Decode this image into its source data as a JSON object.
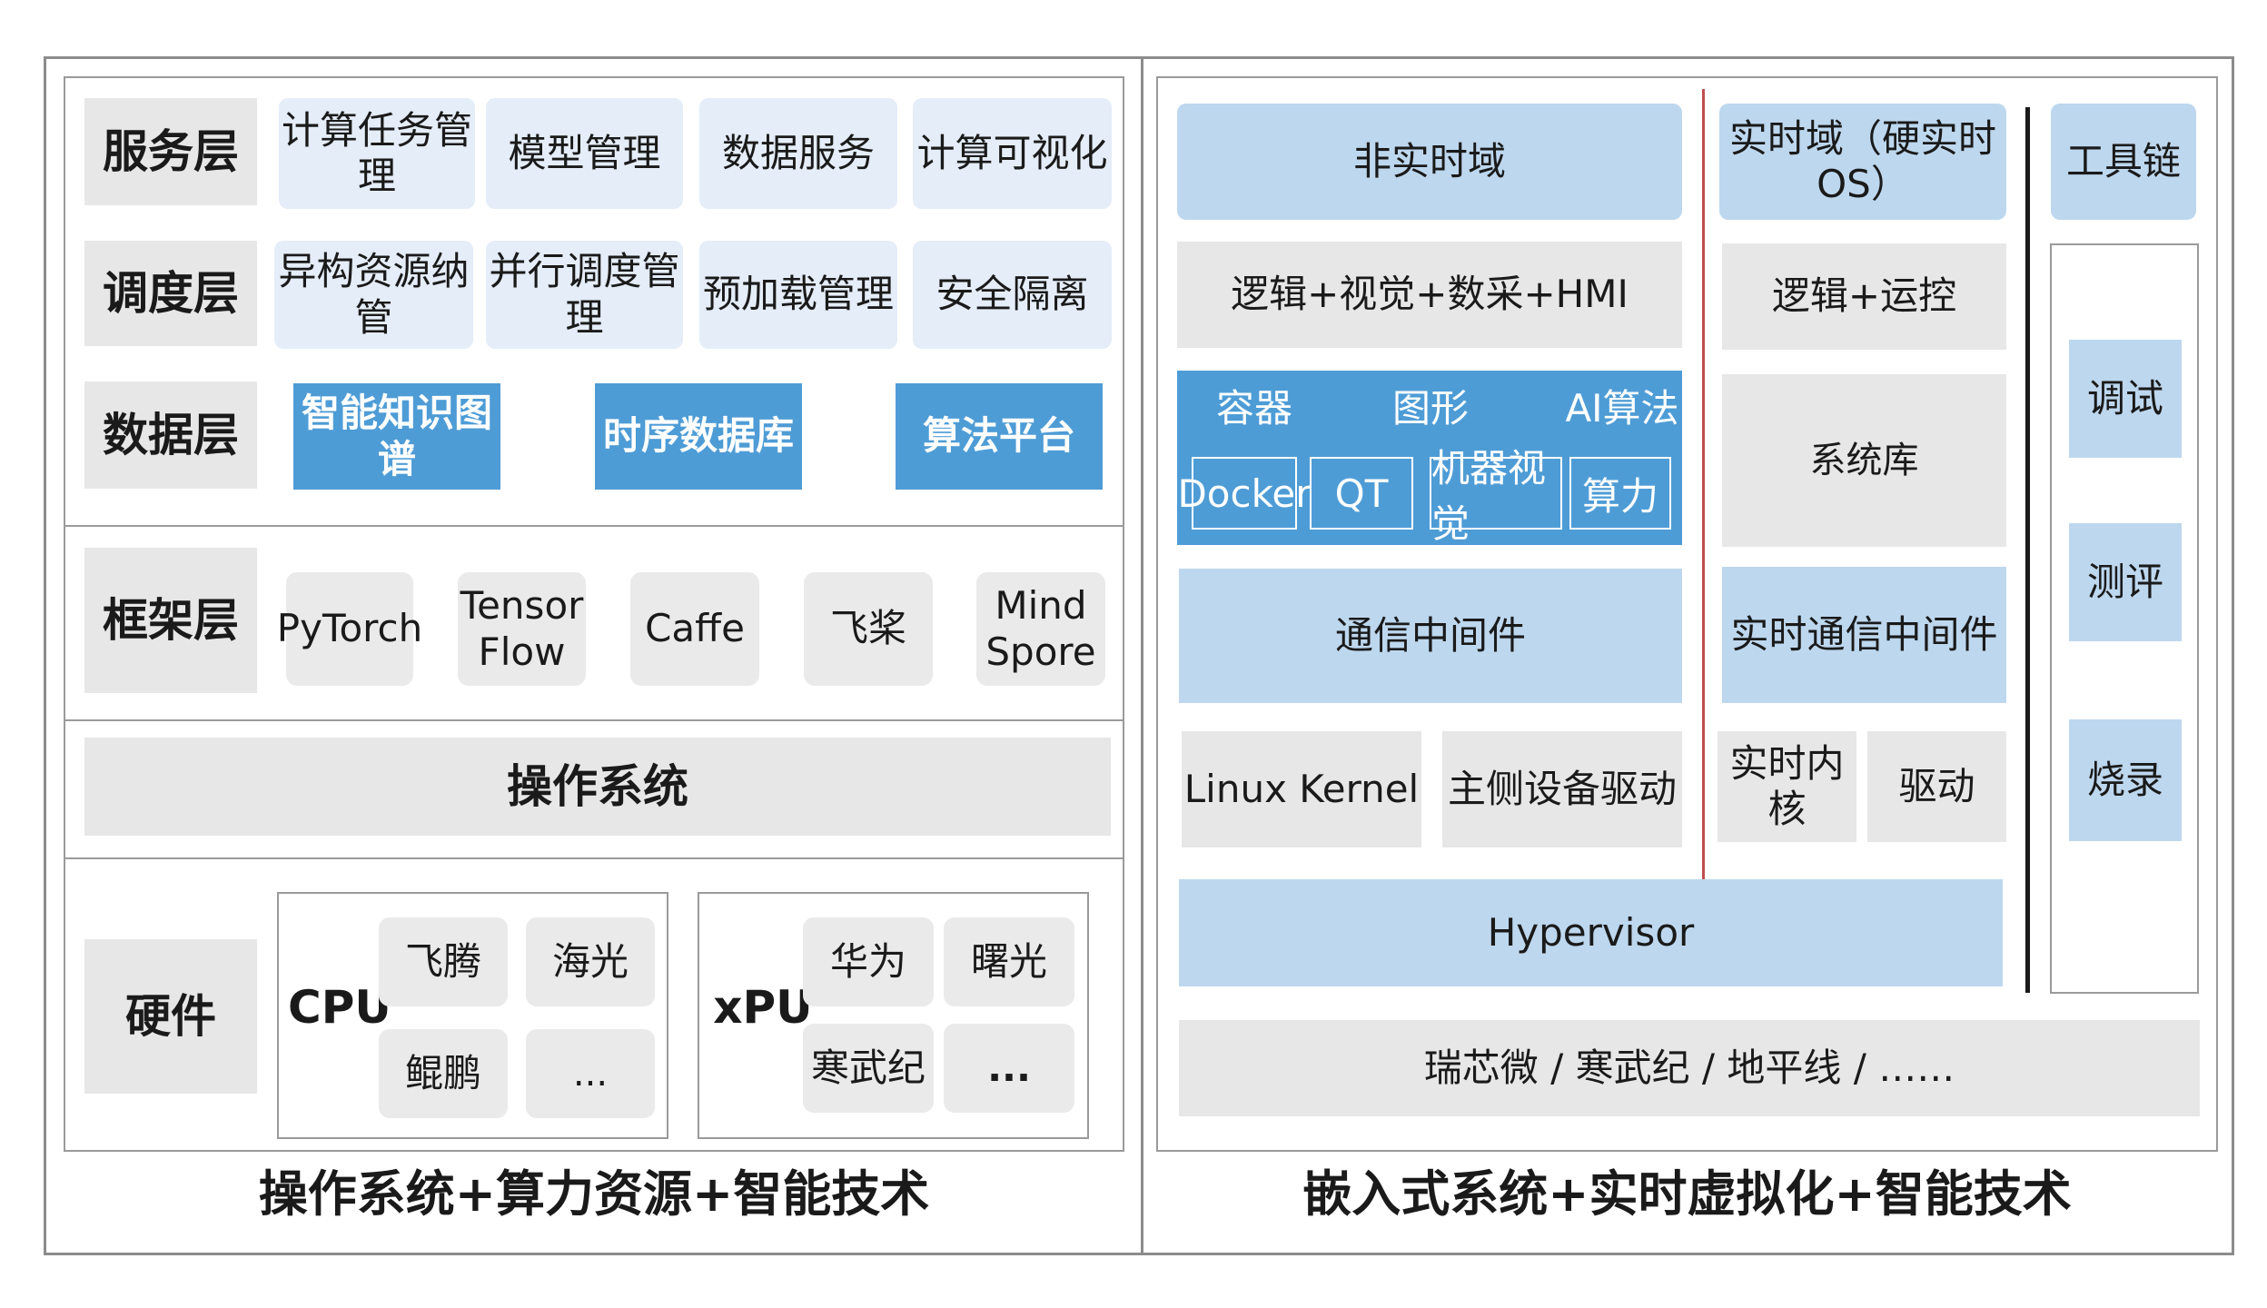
{
  "left": {
    "caption": "操作系统+算力资源+智能技术",
    "service_layer": {
      "label": "服务层",
      "items": [
        "计算任务管理",
        "模型管理",
        "数据服务",
        "计算可视化"
      ]
    },
    "schedule_layer": {
      "label": "调度层",
      "items": [
        "异构资源纳管",
        "并行调度管理",
        "预加载管理",
        "安全隔离"
      ]
    },
    "data_layer": {
      "label": "数据层",
      "items": [
        "智能知识图谱",
        "时序数据库",
        "算法平台"
      ]
    },
    "framework_layer": {
      "label": "框架层",
      "items": [
        "PyTorch",
        "Tensor\nFlow",
        "Caffe",
        "飞桨",
        "Mind\nSpore"
      ]
    },
    "os": {
      "label": "操作系统"
    },
    "hardware": {
      "label": "硬件",
      "cpu": {
        "label": "CPU",
        "items": [
          "飞腾",
          "海光",
          "鲲鹏",
          "..."
        ]
      },
      "xpu": {
        "label": "xPU",
        "items": [
          "华为",
          "曙光",
          "寒武纪",
          "..."
        ]
      }
    }
  },
  "right": {
    "caption": "嵌入式系统+实时虚拟化+智能技术",
    "non_rt": {
      "header": "非实时域",
      "app": "逻辑+视觉+数采+HMI",
      "container": {
        "labels": [
          "容器",
          "图形",
          "AI算法"
        ],
        "cells": [
          "Docker",
          "QT",
          "机器视觉",
          "算力"
        ]
      },
      "middleware": "通信中间件",
      "kernel": "Linux Kernel",
      "driver": "主侧设备驱动"
    },
    "rt": {
      "header": "实时域（硬实时OS）",
      "app": "逻辑+运控",
      "lib": "系统库",
      "middleware": "实时通信中间件",
      "kernel": "实时内核",
      "driver": "驱动"
    },
    "toolchain": {
      "header": "工具链",
      "items": [
        "调试",
        "测评",
        "烧录"
      ]
    },
    "hypervisor": "Hypervisor",
    "chips": "瑞芯微 / 寒武纪 / 地平线 / ……"
  },
  "colors": {
    "dark_blue": "#4e9cd6",
    "light_blue": "#bdd7ee",
    "pale_blue": "#e4edf8",
    "gray": "#e7e7e7",
    "red_divider": "#c0504d"
  }
}
